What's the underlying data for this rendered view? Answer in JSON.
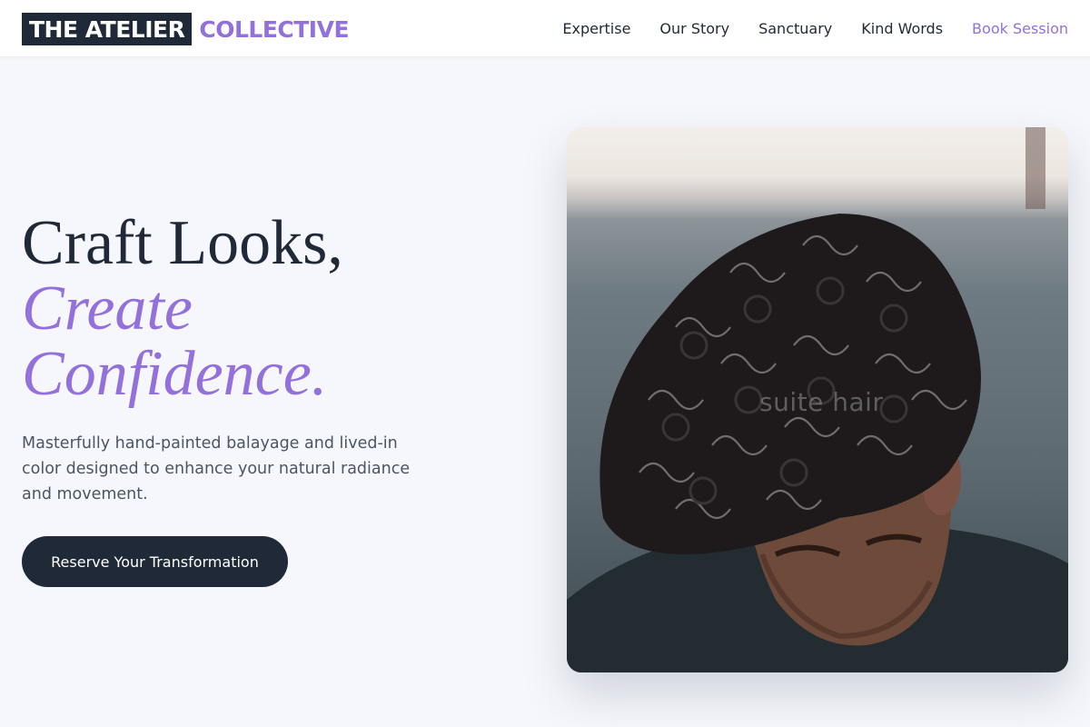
{
  "brand": {
    "part1": "THE ATELIER",
    "part2": "COLLECTIVE"
  },
  "nav": {
    "items": [
      "Expertise",
      "Our Story",
      "Sanctuary",
      "Kind Words"
    ],
    "cta": "Book Session"
  },
  "hero": {
    "title_line1": "Craft Looks,",
    "title_line2": "Create",
    "title_line3": "Confidence.",
    "subtitle": "Masterfully hand-painted balayage and lived-in color designed to enhance your natural radiance and movement.",
    "button_label": "Reserve Your Transformation"
  },
  "photo": {
    "overlay_text": "suite hair",
    "subject": "man-with-curly-hair"
  },
  "colors": {
    "accent": "#9370db",
    "dark": "#1f2937",
    "background": "#f6f7fc",
    "body_text": "#4b5563"
  }
}
